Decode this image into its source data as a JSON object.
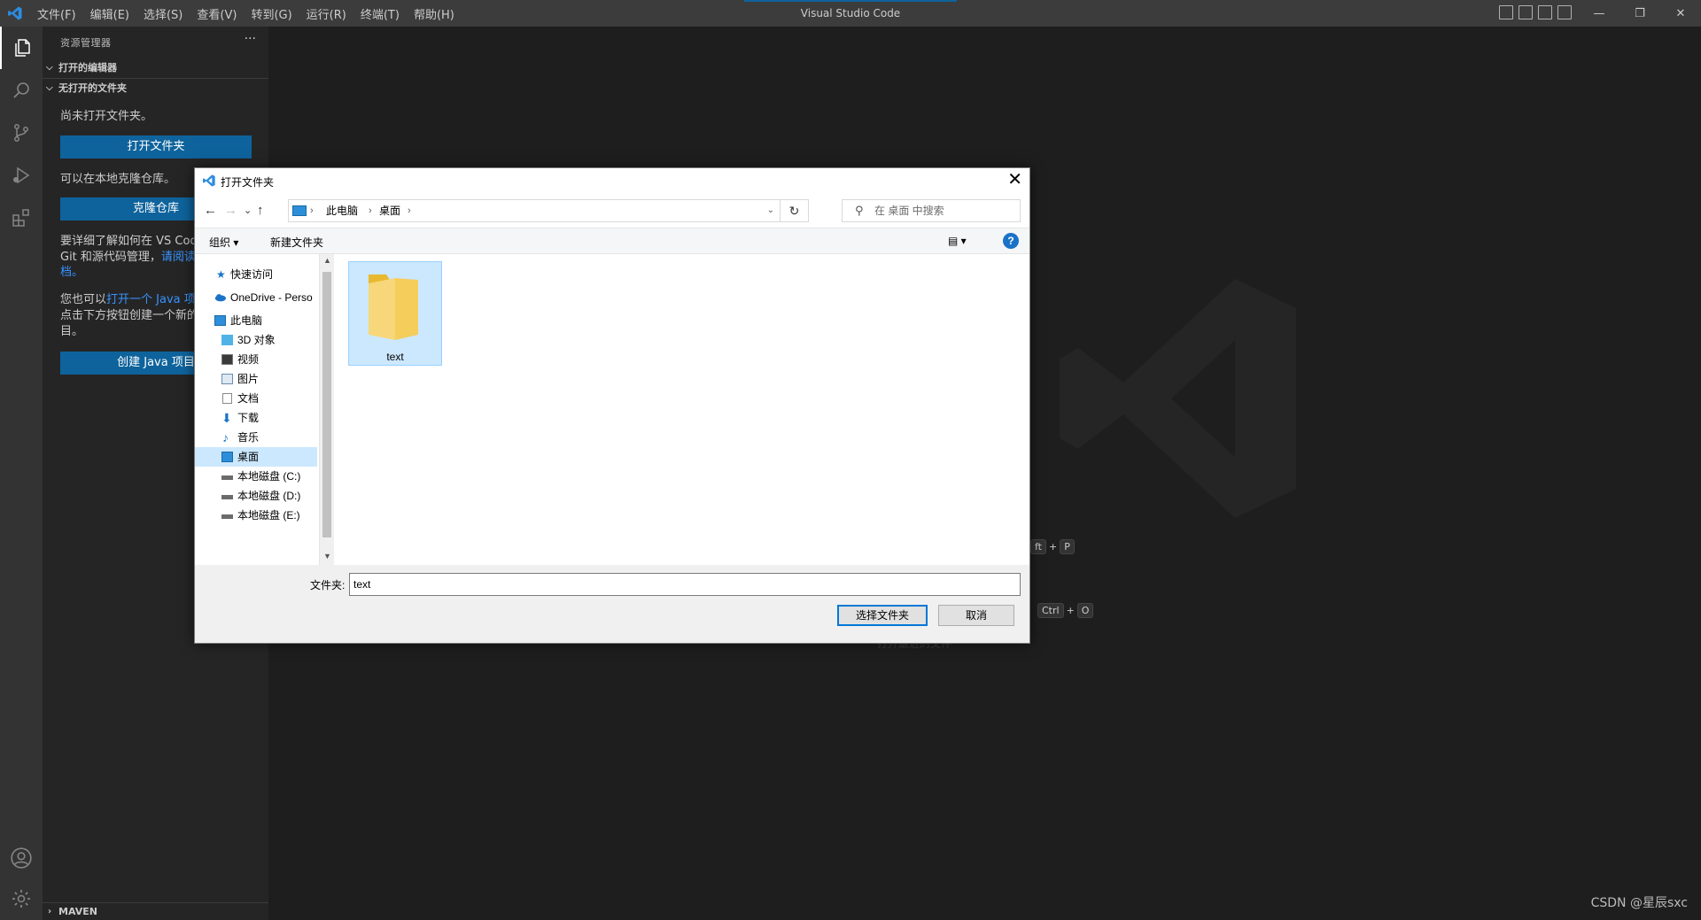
{
  "titlebar": {
    "menu": [
      "文件(F)",
      "编辑(E)",
      "选择(S)",
      "查看(V)",
      "转到(G)",
      "运行(R)",
      "终端(T)",
      "帮助(H)"
    ],
    "title": "Visual Studio Code",
    "window_controls": [
      "—",
      "❐",
      "✕"
    ]
  },
  "activitybar": {
    "icons": [
      "explorer-icon",
      "search-icon",
      "source-control-icon",
      "run-debug-icon",
      "extensions-icon",
      "account-icon",
      "settings-gear-icon"
    ]
  },
  "sidebar": {
    "header": "资源管理器",
    "more": "···",
    "open_editors": "打开的编辑器",
    "no_folder": "无打开的文件夹",
    "no_folder_text": "尚未打开文件夹。",
    "open_folder_button": "打开文件夹",
    "clone_text": "可以在本地克隆仓库。",
    "clone_button": "克隆仓库",
    "learn_line1": "要详细了解如何在 VS Cod",
    "learn_line2_a": "Git 和源代码管理，",
    "learn_line2_link": "请阅读",
    "learn_line3": "档。",
    "java_line1_a": "您也可以",
    "java_line1_link": "打开一个 Java 项",
    "java_line2": "点击下方按钮创建一个新的",
    "java_line3": "目。",
    "create_java_button": "创建 Java 项目",
    "maven": "MAVEN"
  },
  "editor": {
    "shortcut1": [
      "ft",
      "P"
    ],
    "shortcut2": [
      "Ctrl",
      "O"
    ],
    "faint_text": "打开最近的文件"
  },
  "watermark": "CSDN @星辰sxc",
  "dialog": {
    "title": "打开文件夹",
    "close": "✕",
    "nav": {
      "back": "←",
      "forward": "→",
      "recent": "⌄",
      "up": "↑"
    },
    "address": {
      "crumbs": [
        "此电脑",
        "桌面"
      ],
      "sep": "›",
      "dropdown": "⌄",
      "refresh": "↻"
    },
    "search_placeholder": "在 桌面 中搜索",
    "toolbar": {
      "organize": "组织 ▾",
      "new_folder": "新建文件夹",
      "view": "▤ ▾",
      "help": "?"
    },
    "nav_items": [
      {
        "label": "快速访问",
        "icon": "star-icon"
      },
      {
        "label": "OneDrive - Perso",
        "icon": "cloud-icon"
      },
      {
        "label": "此电脑",
        "icon": "computer-icon"
      },
      {
        "label": "3D 对象",
        "icon": "cube-icon"
      },
      {
        "label": "视频",
        "icon": "video-icon"
      },
      {
        "label": "图片",
        "icon": "pictures-icon"
      },
      {
        "label": "文档",
        "icon": "document-icon"
      },
      {
        "label": "下载",
        "icon": "download-icon"
      },
      {
        "label": "音乐",
        "icon": "music-icon"
      },
      {
        "label": "桌面",
        "icon": "desktop-icon",
        "selected": true
      },
      {
        "label": "本地磁盘 (C:)",
        "icon": "drive-icon"
      },
      {
        "label": "本地磁盘 (D:)",
        "icon": "drive-icon"
      },
      {
        "label": "本地磁盘 (E:)",
        "icon": "drive-icon"
      }
    ],
    "folder_name": "text",
    "folder_label": "文件夹:",
    "folder_value": "text",
    "select_button": "选择文件夹",
    "cancel_button": "取消"
  },
  "colors": {
    "accent": "#0e639c",
    "selection": "#cce8ff",
    "link": "#3794ff"
  }
}
